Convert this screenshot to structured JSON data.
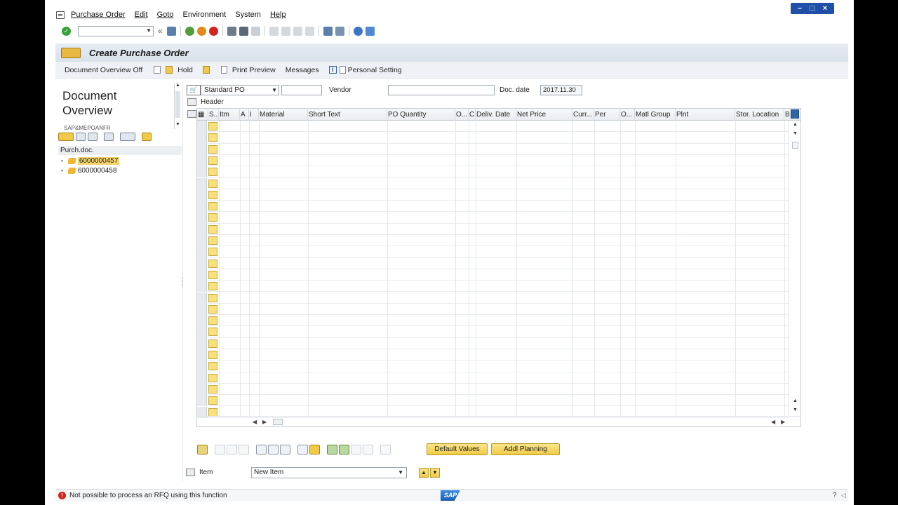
{
  "menu": {
    "items": [
      "Purchase Order",
      "Edit",
      "Goto",
      "Environment",
      "System",
      "Help"
    ],
    "underline_index": [
      0,
      0,
      0,
      0,
      1,
      0
    ]
  },
  "window_controls": {
    "minimize": "–",
    "maximize": "□",
    "close": "×"
  },
  "system_toolbar": {
    "command_value": ""
  },
  "title": "Create Purchase Order",
  "app_toolbar": {
    "doc_overview": "Document Overview Off",
    "hold": "Hold",
    "print_preview": "Print Preview",
    "messages": "Messages",
    "personal_setting": "Personal Setting"
  },
  "left_pane": {
    "title": "Document Overview",
    "variant": "SAP&MEPOANFR",
    "tree_header": "Purch.doc.",
    "documents": [
      "6000000457",
      "6000000458"
    ]
  },
  "header": {
    "po_type": "Standard PO",
    "po_number": "",
    "vendor_label": "Vendor",
    "vendor_value": "",
    "doc_date_label": "Doc. date",
    "doc_date_value": "2017.11.30",
    "toggle_label": "Header"
  },
  "grid": {
    "columns": [
      "S..",
      "Itm",
      "A",
      "I",
      "Material",
      "Short Text",
      "PO Quantity",
      "O...",
      "C",
      "Deliv. Date",
      "Net Price",
      "Curr...",
      "Per",
      "O...",
      "Matl Group",
      "Plnt",
      "Stor. Location",
      "B"
    ],
    "row_count": 26
  },
  "item_toolbar": {
    "default_values": "Default Values",
    "addl_planning": "Addl Planning"
  },
  "item_row": {
    "label": "Item",
    "selected": "New Item"
  },
  "status": {
    "message": "Not possible to process an RFQ using this function",
    "logo": "SAP"
  },
  "colors": {
    "accent_yellow": "#f0cb45",
    "error_red": "#d3231c",
    "title_bg": "#dfe6ee"
  }
}
